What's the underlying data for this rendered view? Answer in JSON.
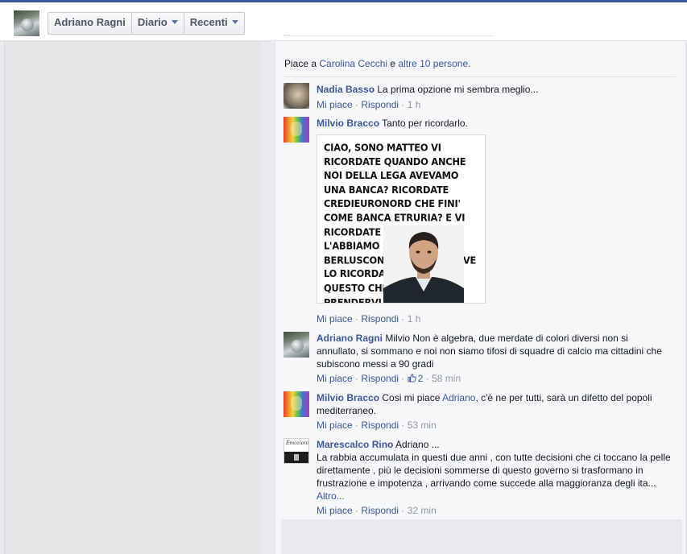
{
  "header": {
    "nav": [
      {
        "label": "Adriano Ragni",
        "has_caret": false
      },
      {
        "label": "Diario",
        "has_caret": true
      },
      {
        "label": "Recenti",
        "has_caret": true
      }
    ]
  },
  "likes": {
    "prefix": "Piace a ",
    "person": "Carolina Cecchi",
    "middle": " e ",
    "others": "altre 10 persone",
    "suffix": "."
  },
  "actions": {
    "like": "Mi piace",
    "reply": "Rispondi",
    "dot": " · "
  },
  "comments": [
    {
      "name": "Nadia Basso",
      "text": "La prima opzione mi sembra meglio...",
      "time": "1 h"
    },
    {
      "name": "Milvio Bracco",
      "text": "Tanto per ricordarlo.",
      "time": "1 h",
      "meme_text": "CIAO, SONO MATTEO VI RICORDATE QUANDO ANCHE NOI DELLA LEGA AVEVAMO UNA BANCA? RICORDATE CREDIEURONORD CHE FINI' COME BANCA ETRURIA? E VI RICORDATE CHE NOI L'ABBIAMO SALVATA CON BERLUSCONI? NO CHE NON VE LO RICORDATE! ED È PER QUESTO CHE CONTINUO A PRENDERVI PER IL CULO."
    },
    {
      "name": "Adriano Ragni",
      "text": "Milvio Non è algebra, due merdate di colori diversi non si annullato, si sommano e noi non siamo tifosi di squadre di calcio ma cittadini che subiscono messi a 90 gradi",
      "time": "58 min",
      "like_count": "2"
    },
    {
      "name": "Milvio Bracco",
      "text_before": "Cosi mi piace ",
      "mention": "Adriano",
      "text_after": ", c'è ne per tutti, sarà un difetto del popoli mediterraneo.",
      "time": "53 min"
    },
    {
      "name": "Marescalco Rino",
      "text_head": "Adriano ...",
      "text": "La rabbia accumulata in questi due anni , con tutte decisioni che ci toccano la pelle direttamente , più le decisioni sommerse di questo governo si trasformano in frustrazione e impotenza , arrivando come succede alla maggioranza degli ita...",
      "more": "Altro...",
      "time": "32 min",
      "avatar_logo": "Emozioni"
    }
  ],
  "colors": {
    "brand": "#3b5998",
    "meta": "#9197a3",
    "text": "#141823"
  }
}
